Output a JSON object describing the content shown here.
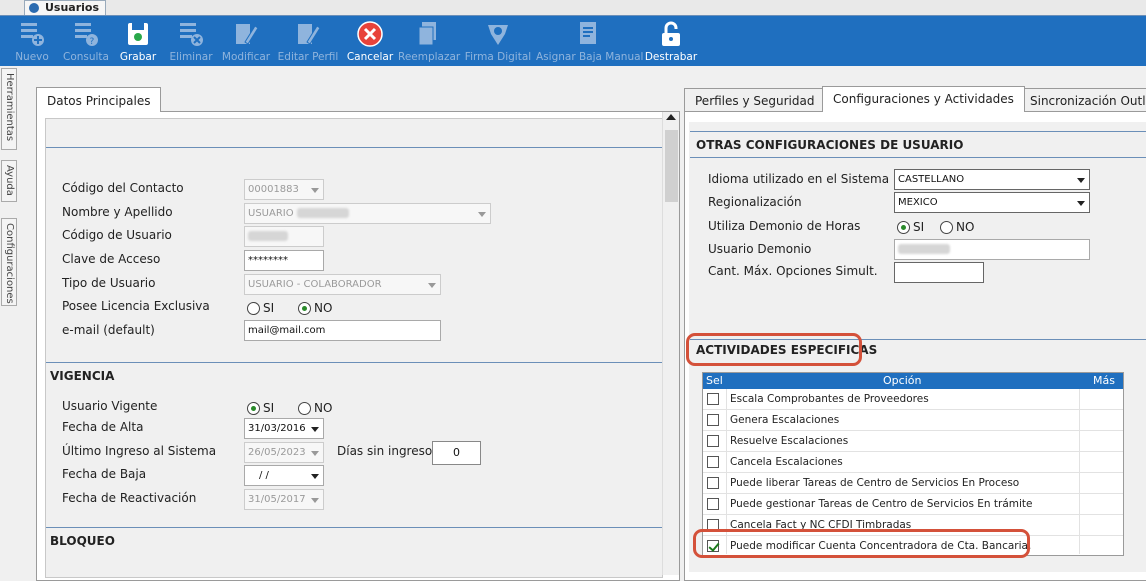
{
  "window": {
    "tab_title": "Usuarios"
  },
  "toolbar": [
    {
      "label": "Nuevo",
      "icon": "new-icon",
      "active": false
    },
    {
      "label": "Consulta",
      "icon": "query-icon",
      "active": false
    },
    {
      "label": "Grabar",
      "icon": "save-icon",
      "active": true
    },
    {
      "label": "Eliminar",
      "icon": "delete-icon",
      "active": false
    },
    {
      "label": "Modificar",
      "icon": "edit-icon",
      "active": false
    },
    {
      "label": "Editar Perfil",
      "icon": "edit-profile-icon",
      "active": false
    },
    {
      "label": "Cancelar",
      "icon": "cancel-icon",
      "active": true
    },
    {
      "label": "Reemplazar",
      "icon": "replace-icon",
      "active": false
    },
    {
      "label": "Firma Digital",
      "icon": "signature-icon",
      "active": false
    },
    {
      "label": "Asignar Baja Manual",
      "icon": "assign-icon",
      "active": false
    },
    {
      "label": "Destrabar",
      "icon": "unlock-icon",
      "active": true
    }
  ],
  "side_tabs": [
    "Herramientas",
    "Ayuda",
    "Configuraciones"
  ],
  "left": {
    "tab": "Datos Principales",
    "fields": {
      "codigo_contacto": {
        "label": "Código del Contacto",
        "value": "00001883"
      },
      "nombre": {
        "label": "Nombre y Apellido",
        "value": "USUARIO"
      },
      "codigo_usuario": {
        "label": "Código de Usuario",
        "value": ""
      },
      "clave": {
        "label": "Clave de Acceso",
        "value": "********"
      },
      "tipo": {
        "label": "Tipo de Usuario",
        "value": "USUARIO - COLABORADOR"
      },
      "licencia": {
        "label": "Posee Licencia Exclusiva",
        "si": "SI",
        "no": "NO",
        "selected": "NO"
      },
      "email": {
        "label": "e-mail (default)",
        "value": "mail@mail.com"
      }
    },
    "vigencia": {
      "title": "VIGENCIA",
      "vigente": {
        "label": "Usuario Vigente",
        "si": "SI",
        "no": "NO",
        "selected": "SI"
      },
      "alta": {
        "label": "Fecha de Alta",
        "value": "31/03/2016"
      },
      "ultimo": {
        "label": "Último Ingreso al Sistema",
        "value": "26/05/2023"
      },
      "dias": {
        "label": "Días sin ingreso",
        "value": "0"
      },
      "baja": {
        "label": "Fecha de Baja",
        "value": "/ /"
      },
      "reactivacion": {
        "label": "Fecha de Reactivación",
        "value": "31/05/2017"
      }
    },
    "bloqueo": {
      "title": "BLOQUEO"
    }
  },
  "right": {
    "tabs": [
      "Perfiles y Seguridad",
      "Configuraciones y Actividades",
      "Sincronización Outlo"
    ],
    "active_tab": 1,
    "otras": {
      "title": "OTRAS CONFIGURACIONES DE USUARIO",
      "idioma": {
        "label": "Idioma utilizado en el Sistema",
        "value": "CASTELLANO"
      },
      "regional": {
        "label": "Regionalización",
        "value": "MEXICO"
      },
      "demonio": {
        "label": "Utiliza Demonio de Horas",
        "si": "SI",
        "no": "NO",
        "selected": "SI"
      },
      "usuario_demonio": {
        "label": "Usuario Demonio",
        "value": ""
      },
      "cant": {
        "label": "Cant. Máx. Opciones Simult.",
        "value": ""
      }
    },
    "actividades": {
      "title": "ACTIVIDADES ESPECIFICAS",
      "headers": {
        "sel": "Sel",
        "opcion": "Opción",
        "mas": "Más"
      },
      "rows": [
        {
          "text": "Escala Comprobantes de Proveedores",
          "checked": false
        },
        {
          "text": "Genera Escalaciones",
          "checked": false
        },
        {
          "text": "Resuelve Escalaciones",
          "checked": false
        },
        {
          "text": "Cancela Escalaciones",
          "checked": false
        },
        {
          "text": "Puede liberar Tareas de Centro de Servicios En Proceso",
          "checked": false
        },
        {
          "text": "Puede gestionar Tareas de Centro de Servicios En trámite",
          "checked": false
        },
        {
          "text": "Cancela Fact y NC CFDI Timbradas",
          "checked": false
        },
        {
          "text": "Puede modificar Cuenta Concentradora de Cta. Bancaria.",
          "checked": true
        }
      ]
    }
  },
  "colors": {
    "toolbar": "#1f6fbf",
    "highlight": "#d4513a",
    "grid_header": "#1f6fbf"
  }
}
